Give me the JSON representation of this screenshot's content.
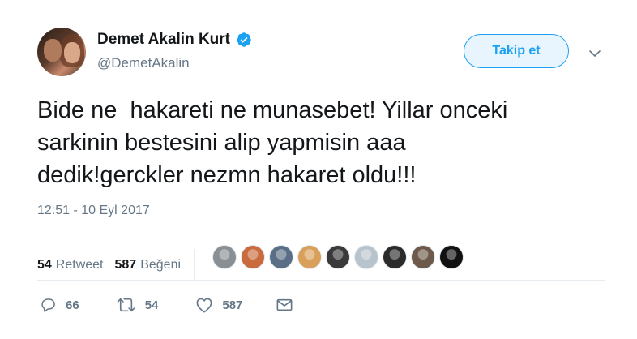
{
  "user": {
    "name": "Demet Akalin Kurt",
    "handle": "@DemetAkalin"
  },
  "follow_label": "Takip et",
  "tweet": {
    "text": "Bide ne  hakareti ne munasebet! Yillar onceki\nsarkinin bestesini alip yapmisin aaa\ndedik!gerckler nezmn hakaret oldu!!!",
    "timestamp": "12:51 - 10 Eyl 2017"
  },
  "stats": {
    "retweet_count": "54",
    "retweet_label": "Retweet",
    "like_count": "587",
    "like_label": "Beğeni"
  },
  "likers": [
    {
      "color": "#8a8f94"
    },
    {
      "color": "#c96b3d"
    },
    {
      "color": "#5a6f86"
    },
    {
      "color": "#d9a05b"
    },
    {
      "color": "#3a3a3a"
    },
    {
      "color": "#b8c4cd"
    },
    {
      "color": "#2b2b2b"
    },
    {
      "color": "#6e5a4a"
    },
    {
      "color": "#111111"
    }
  ],
  "actions": {
    "reply_count": "66",
    "retweet_count": "54",
    "like_count": "587"
  },
  "colors": {
    "accent": "#1da1f2",
    "secondary_text": "#657786"
  }
}
